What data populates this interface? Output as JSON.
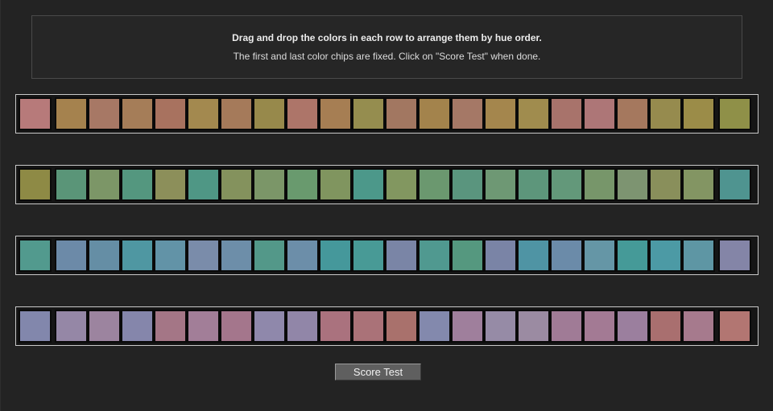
{
  "instructions": {
    "line1": "Drag and drop the colors in each row to arrange them by hue order.",
    "line2": "The first and last color chips are fixed. Click on \"Score Test\" when done."
  },
  "rows": [
    {
      "first": "#b77a7a",
      "middle": [
        "#a5824e",
        "#a77865",
        "#a57d58",
        "#a8725f",
        "#a3894f",
        "#a57a5a",
        "#97894b",
        "#ad7569",
        "#a67e53",
        "#958d4f",
        "#a27761",
        "#a3834c",
        "#a57866",
        "#a4864d",
        "#a08c4e",
        "#a8736b",
        "#ad7677",
        "#a5785e",
        "#968b4e",
        "#9b8c48"
      ],
      "last": "#8f9048"
    },
    {
      "first": "#8e8a45",
      "middle": [
        "#5a9578",
        "#7c9667",
        "#54977f",
        "#8c8f5a",
        "#4f9785",
        "#84925d",
        "#7b9668",
        "#699a6e",
        "#80955f",
        "#4c988a",
        "#829760",
        "#6b986f",
        "#5a957e",
        "#6e9874",
        "#5d967b",
        "#63987a",
        "#77966a",
        "#7d9471",
        "#898f5b",
        "#839563"
      ],
      "last": "#4f9490"
    },
    {
      "first": "#529a8e",
      "middle": [
        "#6c8aa8",
        "#658ea5",
        "#4f97a2",
        "#6293a7",
        "#7a8caa",
        "#6d8ea9",
        "#539889",
        "#6c8ea9",
        "#45989b",
        "#489a96",
        "#7a85a6",
        "#509990",
        "#55987f",
        "#7a84a6",
        "#4f94a4",
        "#6b8ba9",
        "#6596a6",
        "#459a98",
        "#4c9aa5",
        "#5e96a4"
      ],
      "last": "#8485a7"
    },
    {
      "first": "#8287ac",
      "middle": [
        "#9587a6",
        "#9c849f",
        "#8586ab",
        "#a47686",
        "#a27e98",
        "#a4768c",
        "#8f88ab",
        "#9186a8",
        "#aa727e",
        "#aa7278",
        "#a9716c",
        "#8389ad",
        "#9f7f9c",
        "#968ba6",
        "#9b8ba2",
        "#a07b96",
        "#a37a94",
        "#9b7f9e",
        "#a96f6f",
        "#a67a8d"
      ],
      "last": "#b27672"
    }
  ],
  "score_button": {
    "label": "Score Test"
  }
}
